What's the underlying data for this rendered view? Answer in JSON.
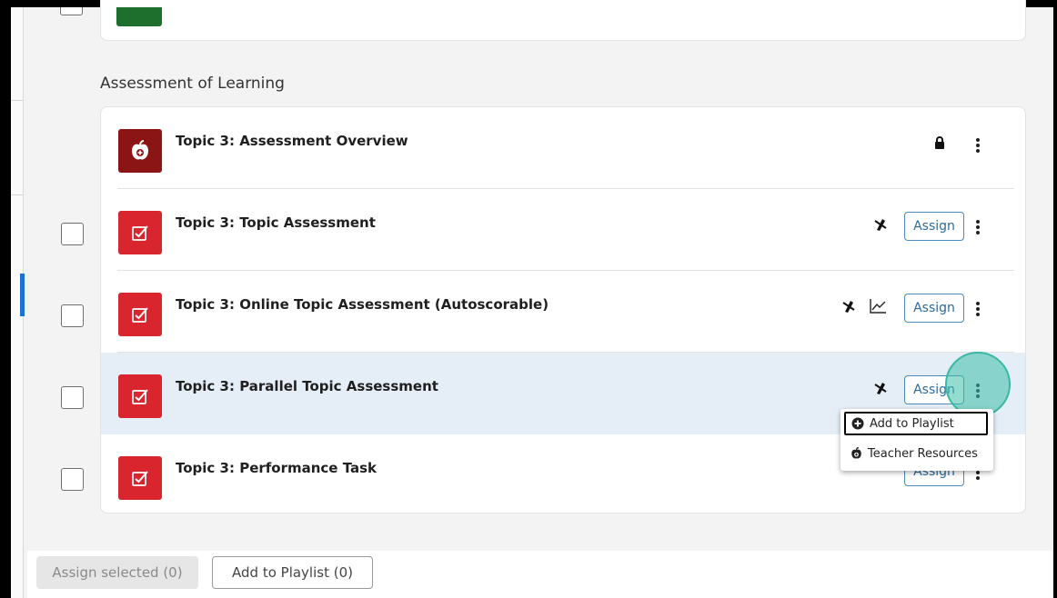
{
  "section": {
    "title": "Assessment of Learning"
  },
  "rows": [
    {
      "title": "Topic 3: Assessment Overview",
      "icon": "apple-icon",
      "has_checkbox": false,
      "locked": true
    },
    {
      "title": "Topic 3: Topic Assessment",
      "icon": "checkbox-edit-icon",
      "has_checkbox": true,
      "assign_label": "Assign"
    },
    {
      "title": "Topic 3: Online Topic Assessment (Autoscorable)",
      "icon": "checkbox-edit-icon",
      "has_checkbox": true,
      "assign_label": "Assign",
      "has_chart_icon": true
    },
    {
      "title": "Topic 3: Parallel Topic Assessment",
      "icon": "checkbox-edit-icon",
      "has_checkbox": true,
      "assign_label": "Assign",
      "highlighted": true
    },
    {
      "title": "Topic 3: Performance Task",
      "icon": "checkbox-edit-icon",
      "has_checkbox": true,
      "assign_label": "Assign"
    }
  ],
  "context_menu": {
    "items": [
      {
        "label": "Add to Playlist",
        "icon": "plus-circle-icon"
      },
      {
        "label": "Teacher Resources",
        "icon": "apple-icon"
      }
    ]
  },
  "bottom_bar": {
    "assign_selected": "Assign selected (0)",
    "add_to_playlist": "Add to Playlist (0)"
  },
  "colors": {
    "tile_red": "#d9262e",
    "tile_maroon": "#8b1414",
    "assign_border": "#4a8cba",
    "highlight_row": "#e5eef7",
    "ripple": "#3bb8a4"
  }
}
